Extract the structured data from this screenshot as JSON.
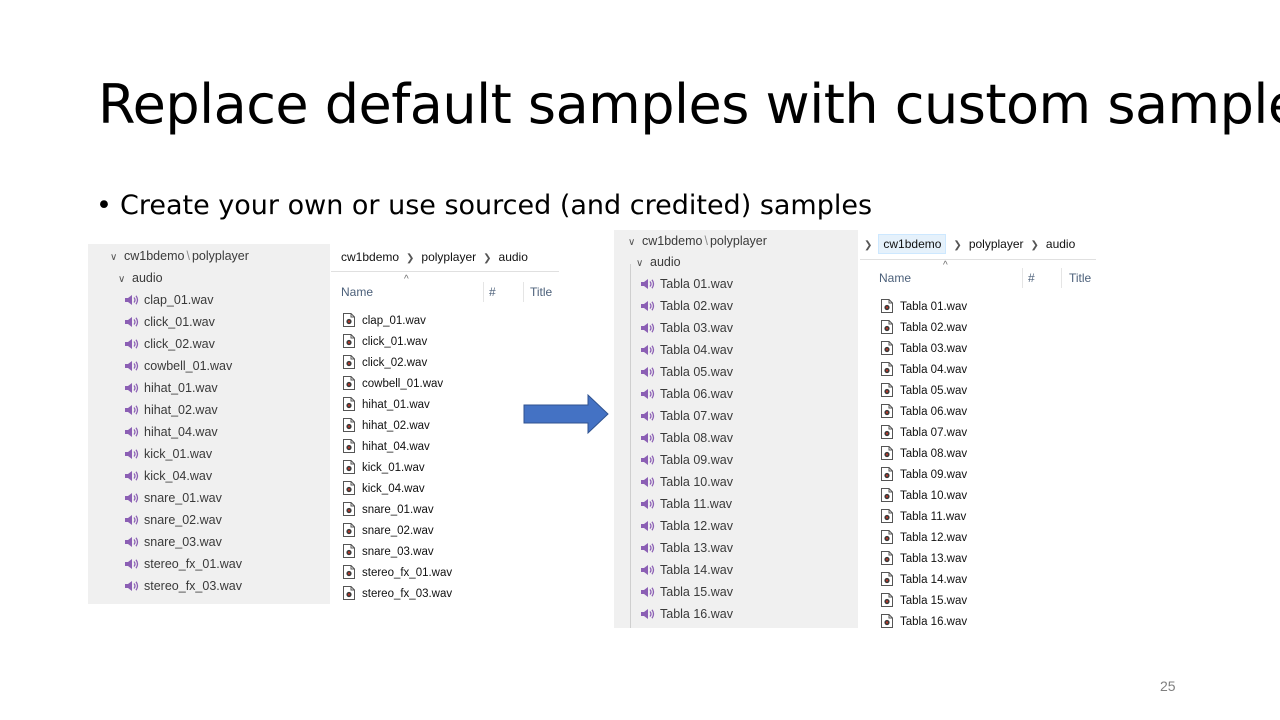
{
  "slide": {
    "title": "Replace default samples with custom samples",
    "bullet": "Create your own or use sourced (and credited) samples",
    "page_number": "25"
  },
  "left_tree": {
    "path_parts": [
      "cw1bdemo",
      "polyplayer"
    ],
    "path_sep": "\\",
    "folder": "audio",
    "files": [
      "clap_01.wav",
      "click_01.wav",
      "click_02.wav",
      "cowbell_01.wav",
      "hihat_01.wav",
      "hihat_02.wav",
      "hihat_04.wav",
      "kick_01.wav",
      "kick_04.wav",
      "snare_01.wav",
      "snare_02.wav",
      "snare_03.wav",
      "stereo_fx_01.wav",
      "stereo_fx_03.wav"
    ]
  },
  "left_list": {
    "breadcrumb": [
      "cw1bdemo",
      "polyplayer",
      "audio"
    ],
    "columns": {
      "name": "Name",
      "number": "#",
      "title": "Title"
    },
    "files": [
      "clap_01.wav",
      "click_01.wav",
      "click_02.wav",
      "cowbell_01.wav",
      "hihat_01.wav",
      "hihat_02.wav",
      "hihat_04.wav",
      "kick_01.wav",
      "kick_04.wav",
      "snare_01.wav",
      "snare_02.wav",
      "snare_03.wav",
      "stereo_fx_01.wav",
      "stereo_fx_03.wav"
    ]
  },
  "right_tree": {
    "path_parts": [
      "cw1bdemo",
      "polyplayer"
    ],
    "path_sep": "\\",
    "folder": "audio",
    "files": [
      "Tabla 01.wav",
      "Tabla 02.wav",
      "Tabla 03.wav",
      "Tabla 04.wav",
      "Tabla 05.wav",
      "Tabla 06.wav",
      "Tabla 07.wav",
      "Tabla 08.wav",
      "Tabla 09.wav",
      "Tabla 10.wav",
      "Tabla 11.wav",
      "Tabla 12.wav",
      "Tabla 13.wav",
      "Tabla 14.wav",
      "Tabla 15.wav",
      "Tabla 16.wav"
    ]
  },
  "right_list": {
    "breadcrumb": [
      "cw1bdemo",
      "polyplayer",
      "audio"
    ],
    "columns": {
      "name": "Name",
      "number": "#",
      "title": "Title"
    },
    "files": [
      "Tabla 01.wav",
      "Tabla 02.wav",
      "Tabla 03.wav",
      "Tabla 04.wav",
      "Tabla 05.wav",
      "Tabla 06.wav",
      "Tabla 07.wav",
      "Tabla 08.wav",
      "Tabla 09.wav",
      "Tabla 10.wav",
      "Tabla 11.wav",
      "Tabla 12.wav",
      "Tabla 13.wav",
      "Tabla 14.wav",
      "Tabla 15.wav",
      "Tabla 16.wav"
    ]
  },
  "icons": {
    "audio_tree_icon": "speaker-icon",
    "audio_file_icon": "audio-file-icon",
    "arrow": "right-arrow-shape"
  },
  "colors": {
    "speaker": "#8b5fb4",
    "arrow_fill": "#4472c4",
    "arrow_stroke": "#2f528f",
    "tree_bg": "#f0f0f0"
  }
}
